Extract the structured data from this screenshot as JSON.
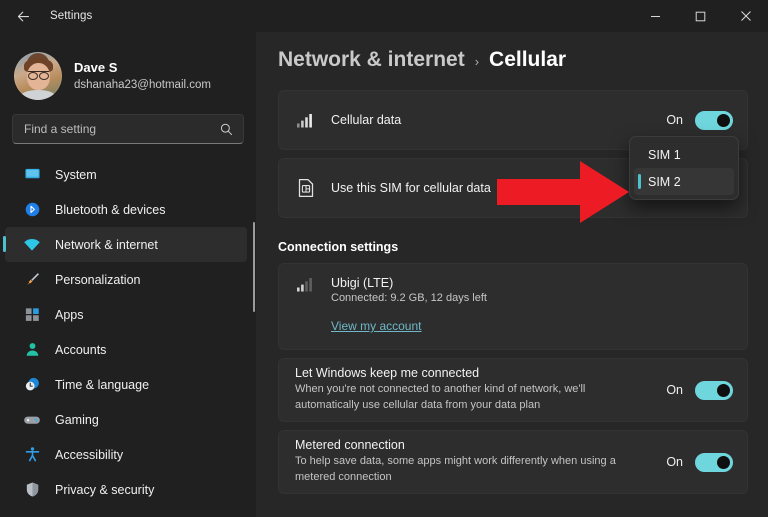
{
  "window": {
    "title": "Settings",
    "back_icon": "back-arrow-icon",
    "minimize_label": "—",
    "maximize_label": "□",
    "close_label": "✕"
  },
  "sidebar": {
    "account": {
      "name": "Dave S",
      "email": "dshanaha23@hotmail.com",
      "avatar": "user-avatar"
    },
    "search": {
      "placeholder": "Find a setting",
      "value": "",
      "icon": "search-icon"
    },
    "items": [
      {
        "label": "System",
        "icon": "system-icon",
        "selected": false
      },
      {
        "label": "Bluetooth & devices",
        "icon": "bluetooth-icon",
        "selected": false
      },
      {
        "label": "Network & internet",
        "icon": "wifi-icon",
        "selected": true
      },
      {
        "label": "Personalization",
        "icon": "paintbrush-icon",
        "selected": false
      },
      {
        "label": "Apps",
        "icon": "apps-icon",
        "selected": false
      },
      {
        "label": "Accounts",
        "icon": "person-icon",
        "selected": false
      },
      {
        "label": "Time & language",
        "icon": "clock-icon",
        "selected": false
      },
      {
        "label": "Gaming",
        "icon": "gamepad-icon",
        "selected": false
      },
      {
        "label": "Accessibility",
        "icon": "accessibility-icon",
        "selected": false
      },
      {
        "label": "Privacy & security",
        "icon": "shield-icon",
        "selected": false
      }
    ]
  },
  "breadcrumb": {
    "parent": "Network & internet",
    "separator": "›",
    "current": "Cellular"
  },
  "main": {
    "cellular_data": {
      "title": "Cellular data",
      "icon": "signal-bars-icon",
      "state": "On"
    },
    "use_sim": {
      "title": "Use this SIM for cellular data",
      "icon": "sim-card-icon"
    },
    "sim_dropdown": {
      "options": [
        "SIM 1",
        "SIM 2"
      ],
      "selected": "SIM 2",
      "accent": "#4cc2cc"
    },
    "connection_settings_heading": "Connection settings",
    "carrier": {
      "name": "Ubigi (LTE)",
      "status": "Connected: 9.2 GB, 12 days left",
      "icon": "signal-bars-weak-icon",
      "link": "View my account"
    },
    "keep_connected": {
      "title": "Let Windows keep me connected",
      "description": "When you're not connected to another kind of network, we'll automatically use cellular data from your data plan",
      "state": "On"
    },
    "metered": {
      "title": "Metered connection",
      "description": "To help save data, some apps might work differently when using a metered connection",
      "state": "On"
    }
  },
  "annotation": {
    "arrow": "red-pointer-arrow",
    "color": "#ed1c24"
  },
  "theme": {
    "accent": "#4cc2cc",
    "toggle_on": "#6fd6de",
    "background": "#202020",
    "content_background": "#272727",
    "card_background": "#2d2d2d"
  }
}
